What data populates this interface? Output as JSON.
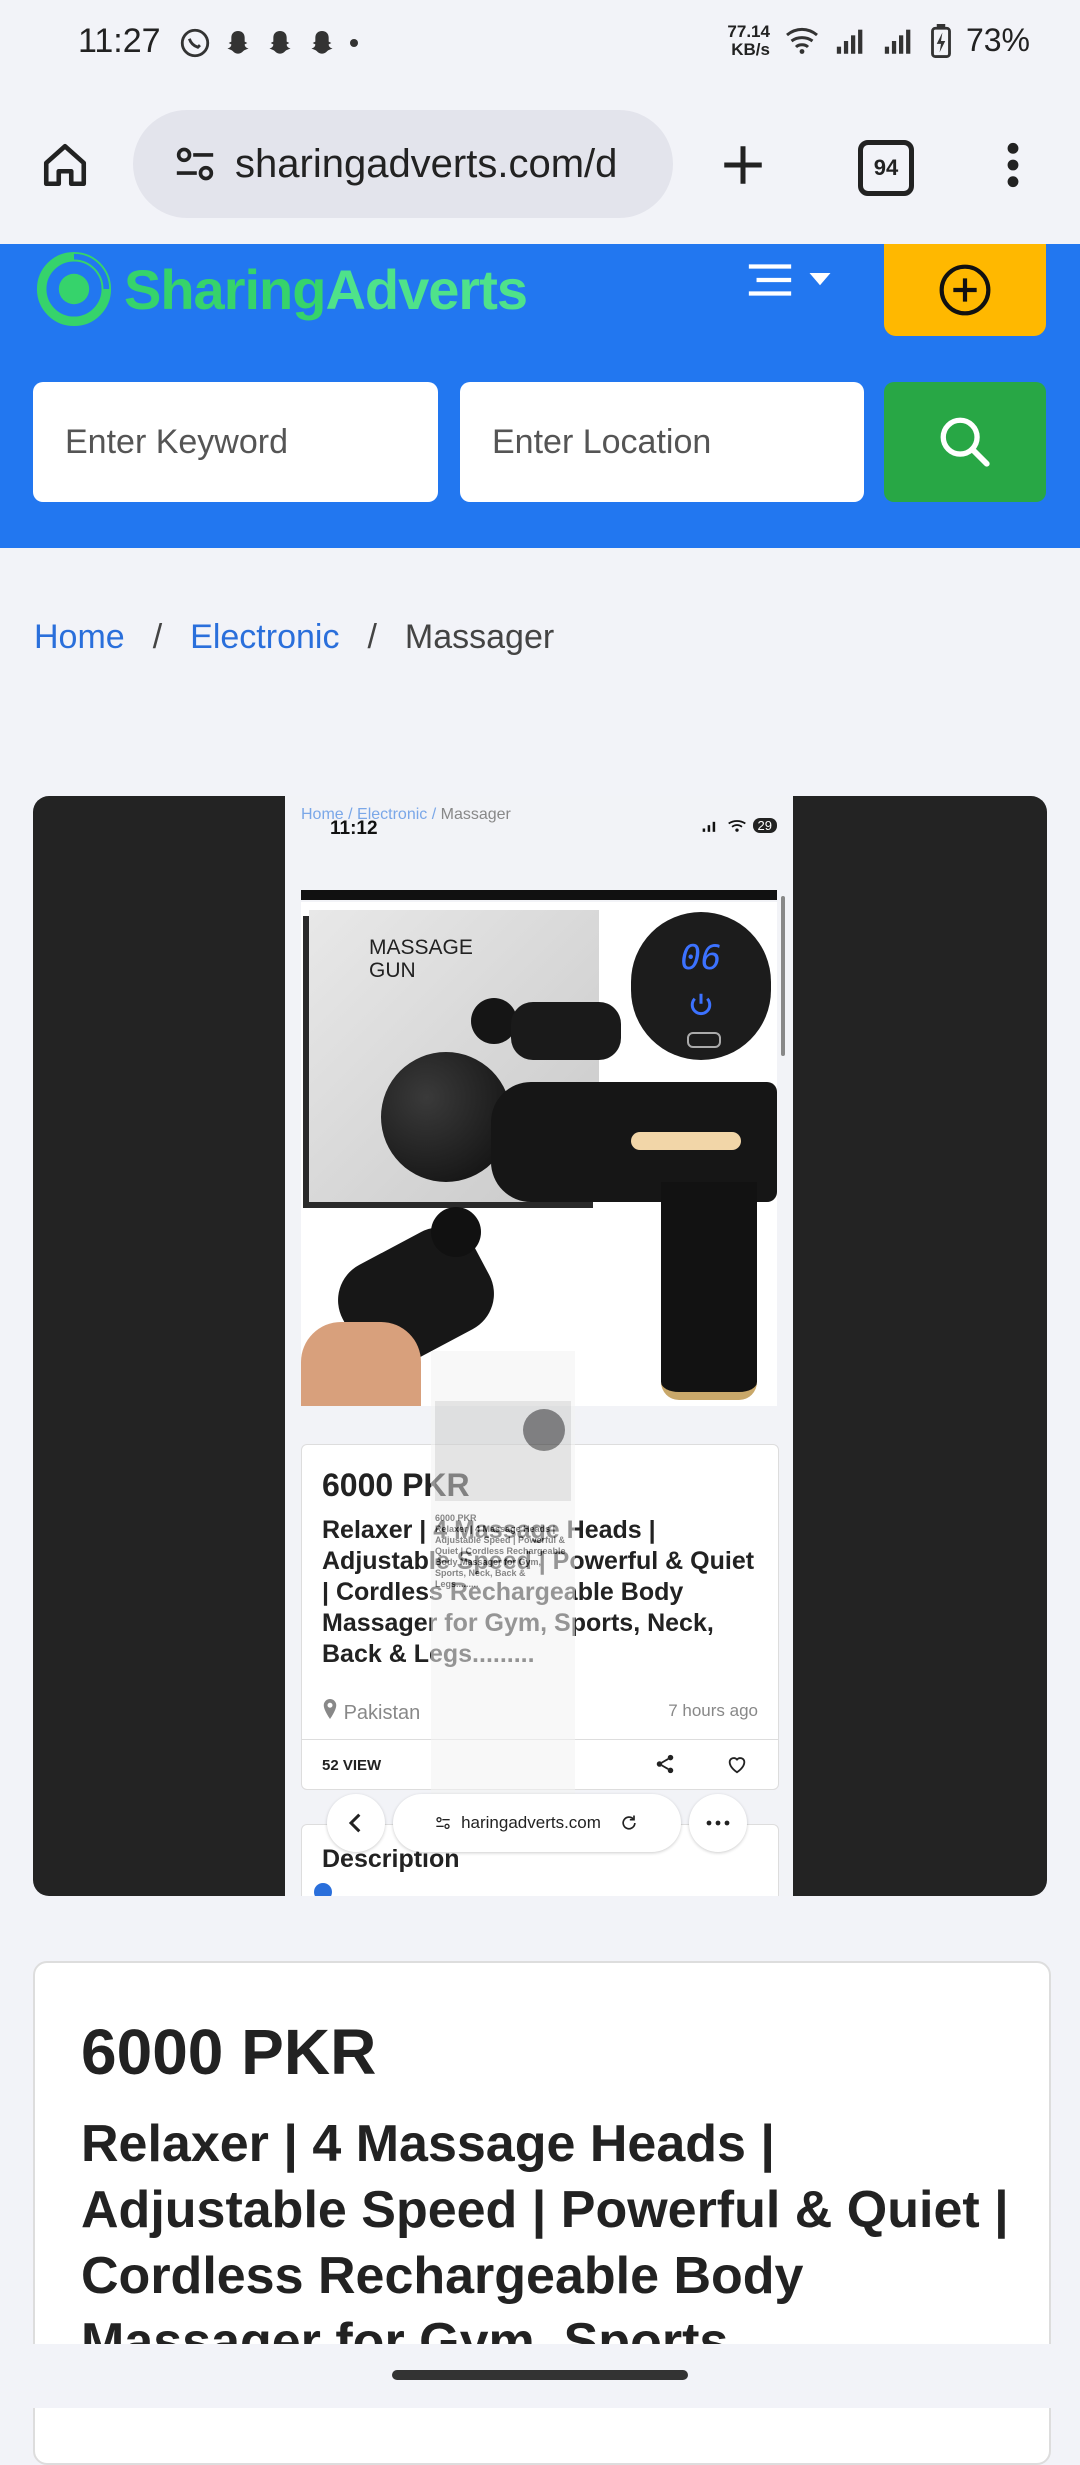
{
  "status_bar": {
    "time": "11:27",
    "net_speed_value": "77.14",
    "net_speed_unit": "KB/s",
    "battery": "73%"
  },
  "browser": {
    "url": "sharingadverts.com/d",
    "tab_count": "94"
  },
  "site": {
    "logo_part1": "Sharing",
    "logo_part2": "Adverts",
    "keyword_placeholder": "Enter Keyword",
    "location_placeholder": "Enter Location"
  },
  "breadcrumb": {
    "home": "Home",
    "sep1": "/",
    "category": "Electronic",
    "sep2": "/",
    "current": "Massager"
  },
  "gallery_screenshot": {
    "crumb_home": "Home",
    "crumb_category": "Electronic",
    "crumb_current": "Massager",
    "time": "11:12",
    "battery": "29",
    "box_label_line1": "MASSAGE",
    "box_label_line2": "GUN",
    "display_digits": "06",
    "price": "6000 PKR",
    "title": "Relaxer | 4 Massage Heads | Adjustable Speed | Powerful & Quiet | Cordless Rechargeable Body Massager for Gym, Sports, Neck, Back & Legs.........",
    "location": "Pakistan",
    "posted": "7 hours ago",
    "views": "52 VIEW",
    "description_heading": "Description",
    "url": "haringadverts.com"
  },
  "listing": {
    "price": "6000 PKR",
    "title": "Relaxer | 4 Massage Heads | Adjustable Speed | Powerful & Quiet | Cordless Rechargeable Body Massager for Gym, Sports"
  },
  "colors": {
    "header_blue": "#2277f0",
    "logo_green": "#36d36b",
    "post_button_yellow": "#ffb800",
    "search_button_green": "#28a745",
    "link_blue": "#2a6fdb"
  }
}
